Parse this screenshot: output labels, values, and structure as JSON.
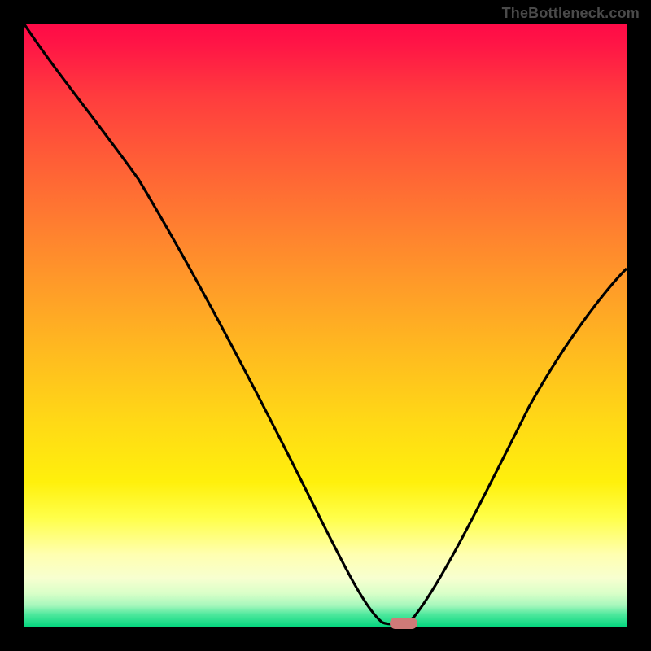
{
  "watermark": "TheBottleneck.com",
  "chart_data": {
    "type": "line",
    "title": "",
    "xlabel": "",
    "ylabel": "",
    "xlim": [
      0,
      100
    ],
    "ylim": [
      0,
      100
    ],
    "grid": false,
    "legend": false,
    "series": [
      {
        "name": "bottleneck-curve",
        "x": [
          0,
          6,
          12,
          18,
          24,
          30,
          36,
          42,
          48,
          53,
          57,
          59.5,
          62,
          64,
          67,
          72,
          78,
          84,
          90,
          96,
          100
        ],
        "y": [
          100,
          94,
          87,
          79,
          71,
          62.5,
          53.5,
          44,
          33,
          21,
          10,
          3,
          0.5,
          0.5,
          6,
          16,
          27,
          36.5,
          44,
          50,
          53.5
        ]
      }
    ],
    "marker": {
      "x": 63,
      "y": 0.6
    },
    "background_gradient": [
      "#ff0b47",
      "#ffff4a",
      "#06d67f"
    ]
  }
}
